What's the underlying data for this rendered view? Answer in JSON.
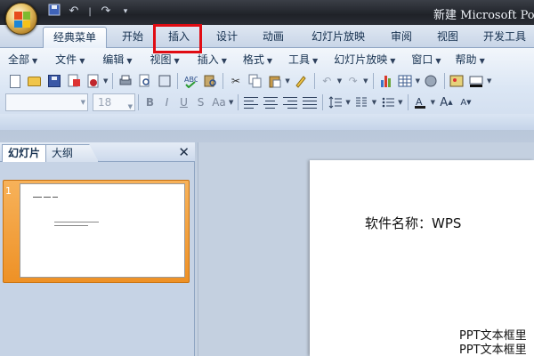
{
  "window": {
    "title": "新建 Microsoft Pow"
  },
  "qat": {
    "save_icon": "save-icon",
    "undo_icon": "undo-icon",
    "redo_icon": "redo-icon",
    "customize_icon": "customize-qat-icon"
  },
  "ribbon_tabs": [
    {
      "label": "经典菜单",
      "active": true
    },
    {
      "label": "开始",
      "active": false
    },
    {
      "label": "插入",
      "active": false,
      "highlighted": true
    },
    {
      "label": "设计",
      "active": false
    },
    {
      "label": "动画",
      "active": false
    },
    {
      "label": "幻灯片放映",
      "active": false
    },
    {
      "label": "审阅",
      "active": false
    },
    {
      "label": "视图",
      "active": false
    },
    {
      "label": "开发工具",
      "active": false
    }
  ],
  "menubar": [
    {
      "label": "全部"
    },
    {
      "label": "文件"
    },
    {
      "label": "编辑"
    },
    {
      "label": "视图"
    },
    {
      "label": "插入"
    },
    {
      "label": "格式"
    },
    {
      "label": "工具"
    },
    {
      "label": "幻灯片放映"
    },
    {
      "label": "窗口"
    },
    {
      "label": "帮助"
    }
  ],
  "font_toolbar": {
    "font_name": "",
    "font_size": "18",
    "bold": "B",
    "italic": "I",
    "underline": "U",
    "shadow": "S",
    "change_case": "Aa"
  },
  "side_panel": {
    "tabs": [
      {
        "label": "幻灯片",
        "active": true
      },
      {
        "label": "大纲",
        "active": false
      }
    ],
    "close_glyph": "✕",
    "slides": [
      {
        "number": "1",
        "selected": true
      }
    ]
  },
  "slide": {
    "title_text": "软件名称：WPS",
    "body_lines": [
      "PPT文本框里",
      "PPT文本框里"
    ]
  },
  "colors": {
    "highlight": "#e00c13",
    "selected_thumb": "#ee9126",
    "ribbon_bg": "#dbe6f4",
    "titlebar": "#1f2228"
  }
}
